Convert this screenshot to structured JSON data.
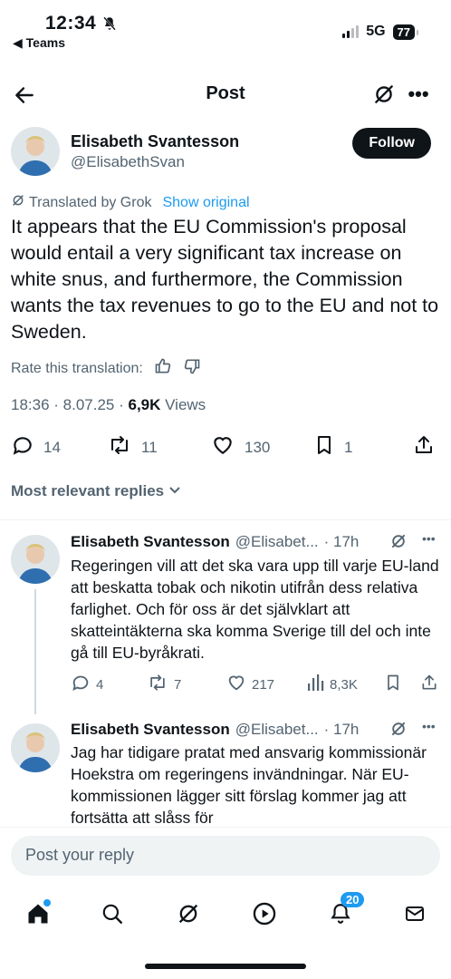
{
  "status_bar": {
    "time": "12:34",
    "back_app": "Teams",
    "network": "5G",
    "battery": "77"
  },
  "header": {
    "title": "Post"
  },
  "post": {
    "author_name": "Elisabeth Svantesson",
    "author_handle": "@ElisabethSvan",
    "follow_label": "Follow",
    "translated_label": "Translated by Grok",
    "show_original": "Show original",
    "text": "It appears that the EU Commission's proposal would entail a very significant tax increase on white snus, and furthermore, the Commission wants the tax revenues to go to the EU and not to Sweden.",
    "rate_label": "Rate this translation:",
    "time": "18:36 · 8.07.25 · ",
    "views_count": "6,9K",
    "views_label": " Views",
    "stats": {
      "replies": "14",
      "reposts": "11",
      "likes": "130",
      "bookmarks": "1"
    }
  },
  "replies_section": {
    "title": "Most relevant replies"
  },
  "replies": [
    {
      "name": "Elisabeth Svantesson",
      "handle": "@Elisabet...",
      "time": "· 17h",
      "text": "Regeringen vill att det ska vara upp till varje EU-land att beskatta tobak och nikotin utifrån dess relativa farlighet. Och för oss är det självklart att skatteintäkterna ska komma Sverige till del och inte gå till EU-byråkrati.",
      "stats": {
        "replies": "4",
        "reposts": "7",
        "likes": "217",
        "views": "8,3K"
      }
    },
    {
      "name": "Elisabeth Svantesson",
      "handle": "@Elisabet...",
      "time": "· 17h",
      "text": "Jag har tidigare pratat med ansvarig kommissionär Hoekstra om regeringens invändningar. När EU-kommissionen lägger sitt förslag kommer jag att fortsätta att slåss för"
    }
  ],
  "composer": {
    "placeholder": "Post your reply"
  },
  "tabbar": {
    "notifications_badge": "20"
  },
  "colors": {
    "accent": "#1d9bf0",
    "text": "#0f1419",
    "muted": "#536471"
  }
}
